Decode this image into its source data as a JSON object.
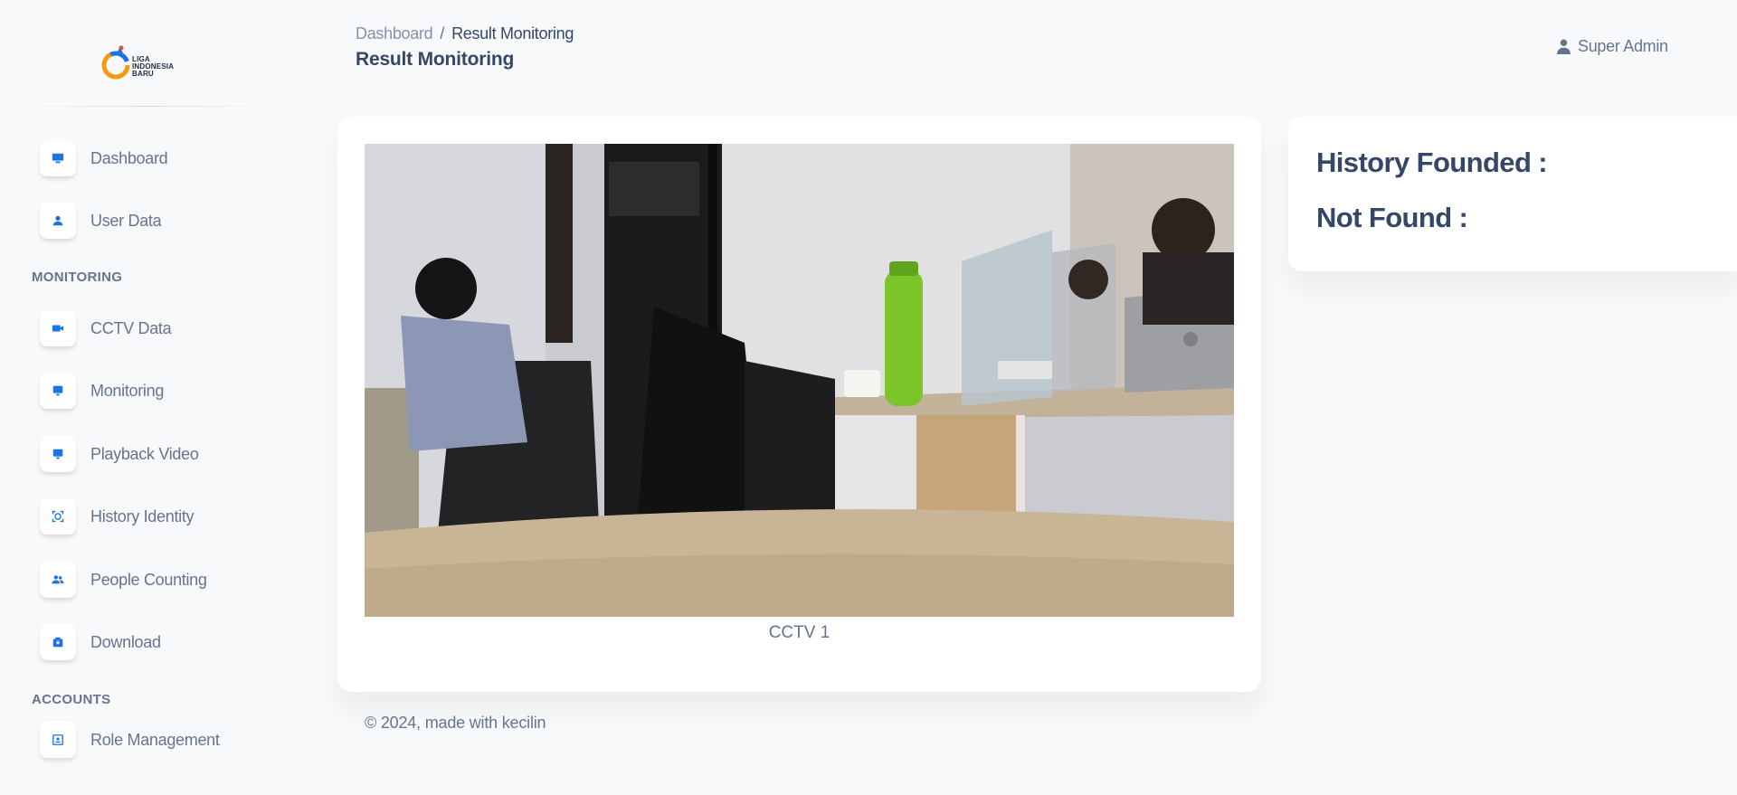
{
  "brand": {
    "logo_lines": [
      "LIGA",
      "INDONESIA",
      "BARU"
    ]
  },
  "sidebar": {
    "items": [
      {
        "label": "Dashboard",
        "icon": "monitor-icon"
      },
      {
        "label": "User Data",
        "icon": "user-icon"
      }
    ],
    "monitoring_title": "MONITORING",
    "monitoring_items": [
      {
        "label": "CCTV Data",
        "icon": "video-camera-icon"
      },
      {
        "label": "Monitoring",
        "icon": "monitor-icon"
      },
      {
        "label": "Playback Video",
        "icon": "monitor-icon"
      },
      {
        "label": "History Identity",
        "icon": "face-scan-icon"
      },
      {
        "label": "People Counting",
        "icon": "users-icon"
      },
      {
        "label": "Download",
        "icon": "download-box-icon"
      }
    ],
    "accounts_title": "ACCOUNTS",
    "accounts_items": [
      {
        "label": "Role Management",
        "icon": "id-card-icon"
      }
    ]
  },
  "header": {
    "breadcrumb_root": "Dashboard",
    "breadcrumb_separator": "/",
    "breadcrumb_current": "Result Monitoring",
    "title": "Result Monitoring",
    "user_name": "Super Admin"
  },
  "video": {
    "caption": "CCTV 1"
  },
  "history": {
    "founded_label": "History Founded :",
    "not_found_label": "Not Found :"
  },
  "footer": {
    "text": "© 2024, made with kecilin"
  },
  "colors": {
    "accent": "#1a73e8",
    "text_primary": "#344767",
    "text_secondary": "#67748e",
    "background": "#f8f9fa"
  }
}
